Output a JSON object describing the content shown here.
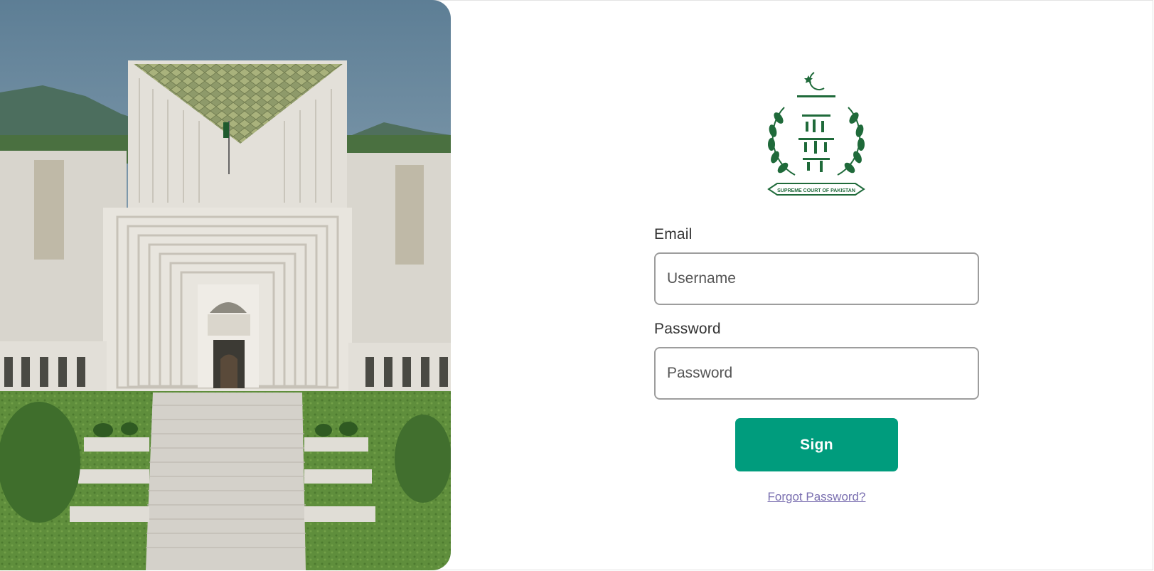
{
  "hero": {
    "image": "supreme-court-building-photo"
  },
  "emblem": {
    "image": "supreme-court-of-pakistan-emblem",
    "ribbon_text": "SUPREME COURT OF PAKISTAN",
    "color": "#1f6a3a"
  },
  "form": {
    "email_label": "Email",
    "email_placeholder": "Username",
    "email_value": "",
    "password_label": "Password",
    "password_placeholder": "Password",
    "password_value": "",
    "sign_label": "Sign",
    "forgot_label": "Forgot Password?"
  },
  "colors": {
    "primary": "#009c7d",
    "link": "#7a6fb0",
    "border": "#9d9d9d"
  }
}
